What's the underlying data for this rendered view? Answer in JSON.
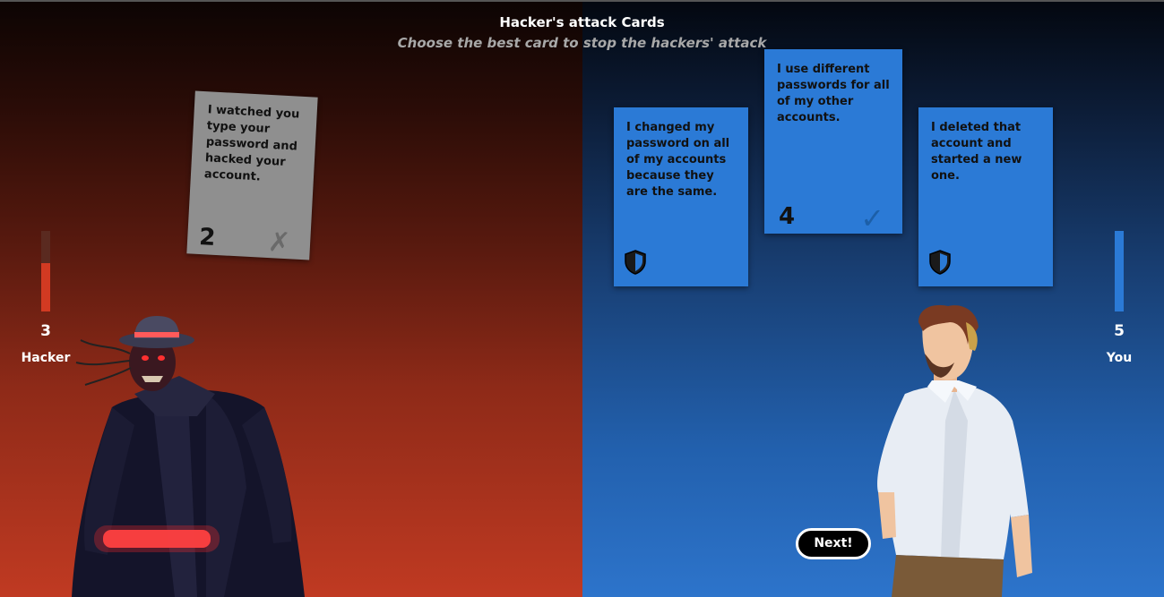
{
  "header": {
    "title": "Hacker's attack Cards",
    "subtitle": "Choose the best card to stop the hackers' attack"
  },
  "hacker": {
    "score": "3",
    "label": "Hacker",
    "meter_fill": 0.6,
    "meter_color": "#d23a22"
  },
  "player": {
    "score": "5",
    "label": "You",
    "meter_fill": 1.0,
    "meter_color": "#2b7ad6"
  },
  "attack_card": {
    "text": "I watched you type your password and hacked your account.",
    "number": "2",
    "mark": "✗",
    "color": "#8f8f8f"
  },
  "defense_cards": [
    {
      "text": "I changed my password on all of my accounts because they are the same.",
      "icon": "shield-icon"
    },
    {
      "text": "I use different passwords for all of my other accounts.",
      "number": "4",
      "mark": "✓",
      "selected": true
    },
    {
      "text": "I deleted that account and started a new one.",
      "icon": "shield-icon"
    }
  ],
  "next_button": {
    "label": "Next!"
  }
}
